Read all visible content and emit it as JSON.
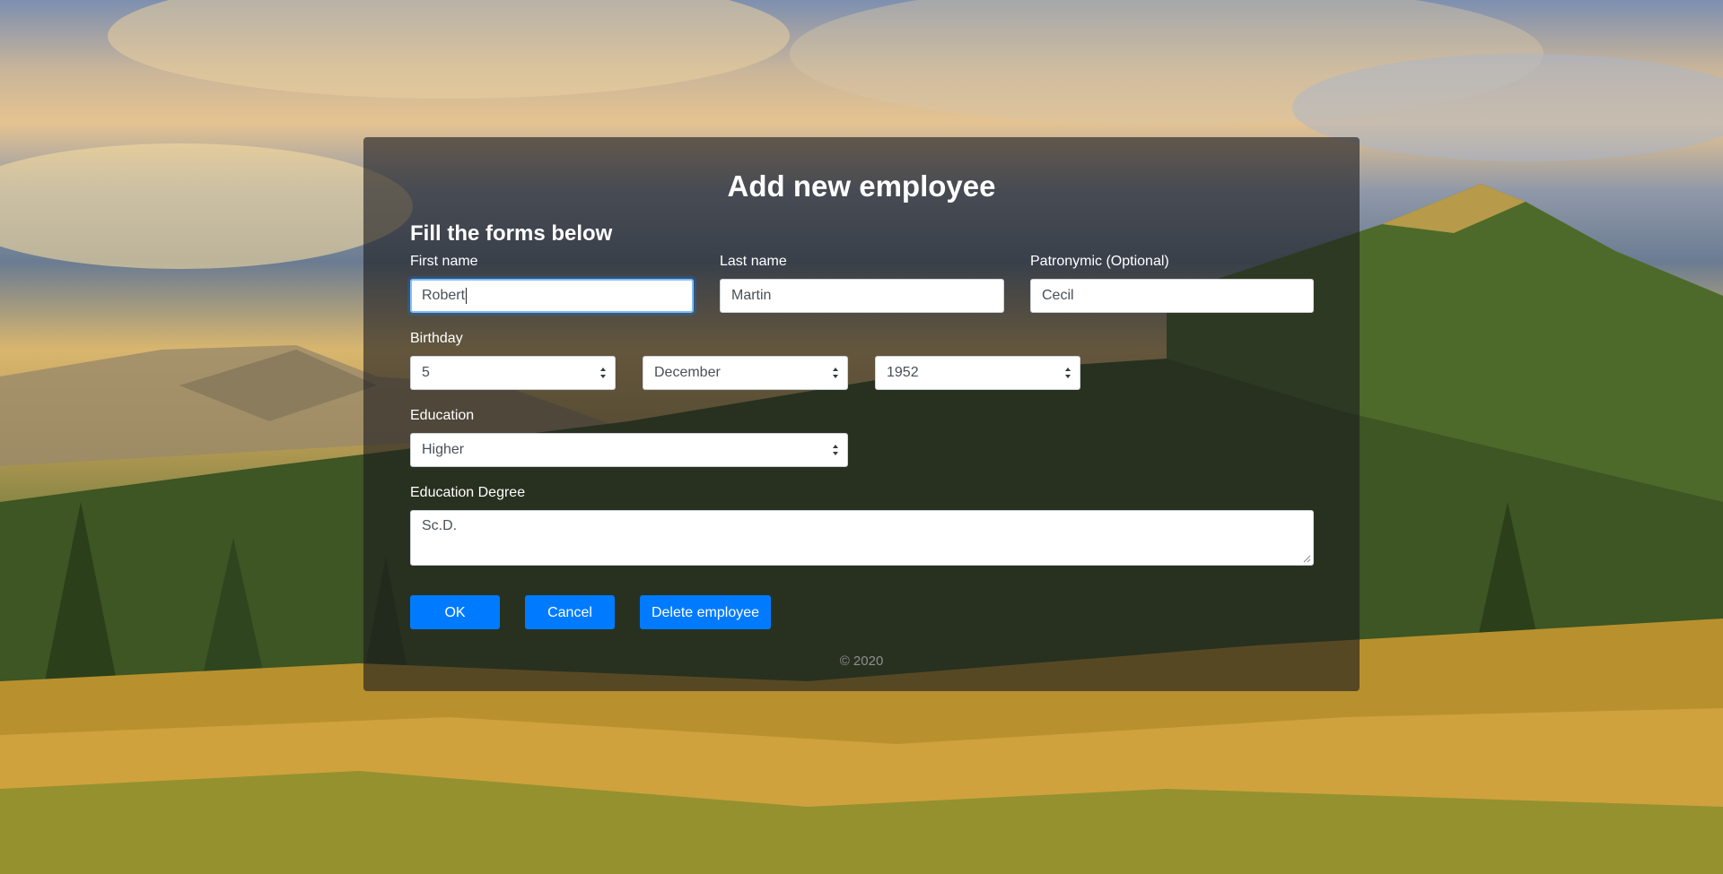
{
  "page": {
    "title": "Add new employee",
    "subtitle": "Fill the forms below",
    "footer": "© 2020"
  },
  "fields": {
    "first_name": {
      "label": "First name",
      "value": "Robert"
    },
    "last_name": {
      "label": "Last name",
      "value": "Martin"
    },
    "patronymic": {
      "label": "Patronymic (Optional)",
      "value": "Cecil"
    },
    "birthday": {
      "label": "Birthday",
      "day": "5",
      "month": "December",
      "year": "1952"
    },
    "education": {
      "label": "Education",
      "value": "Higher"
    },
    "education_degree": {
      "label": "Education Degree",
      "value": "Sc.D."
    }
  },
  "buttons": {
    "ok": "OK",
    "cancel": "Cancel",
    "delete": "Delete employee"
  },
  "colors": {
    "primary_button": "#007bff",
    "panel_overlay": "rgba(28,28,30,0.62)",
    "focus_ring": "#80bdff"
  },
  "icons": {
    "select_arrow": "updown-chevron-icon",
    "textarea_grip": "resize-grip-icon"
  }
}
